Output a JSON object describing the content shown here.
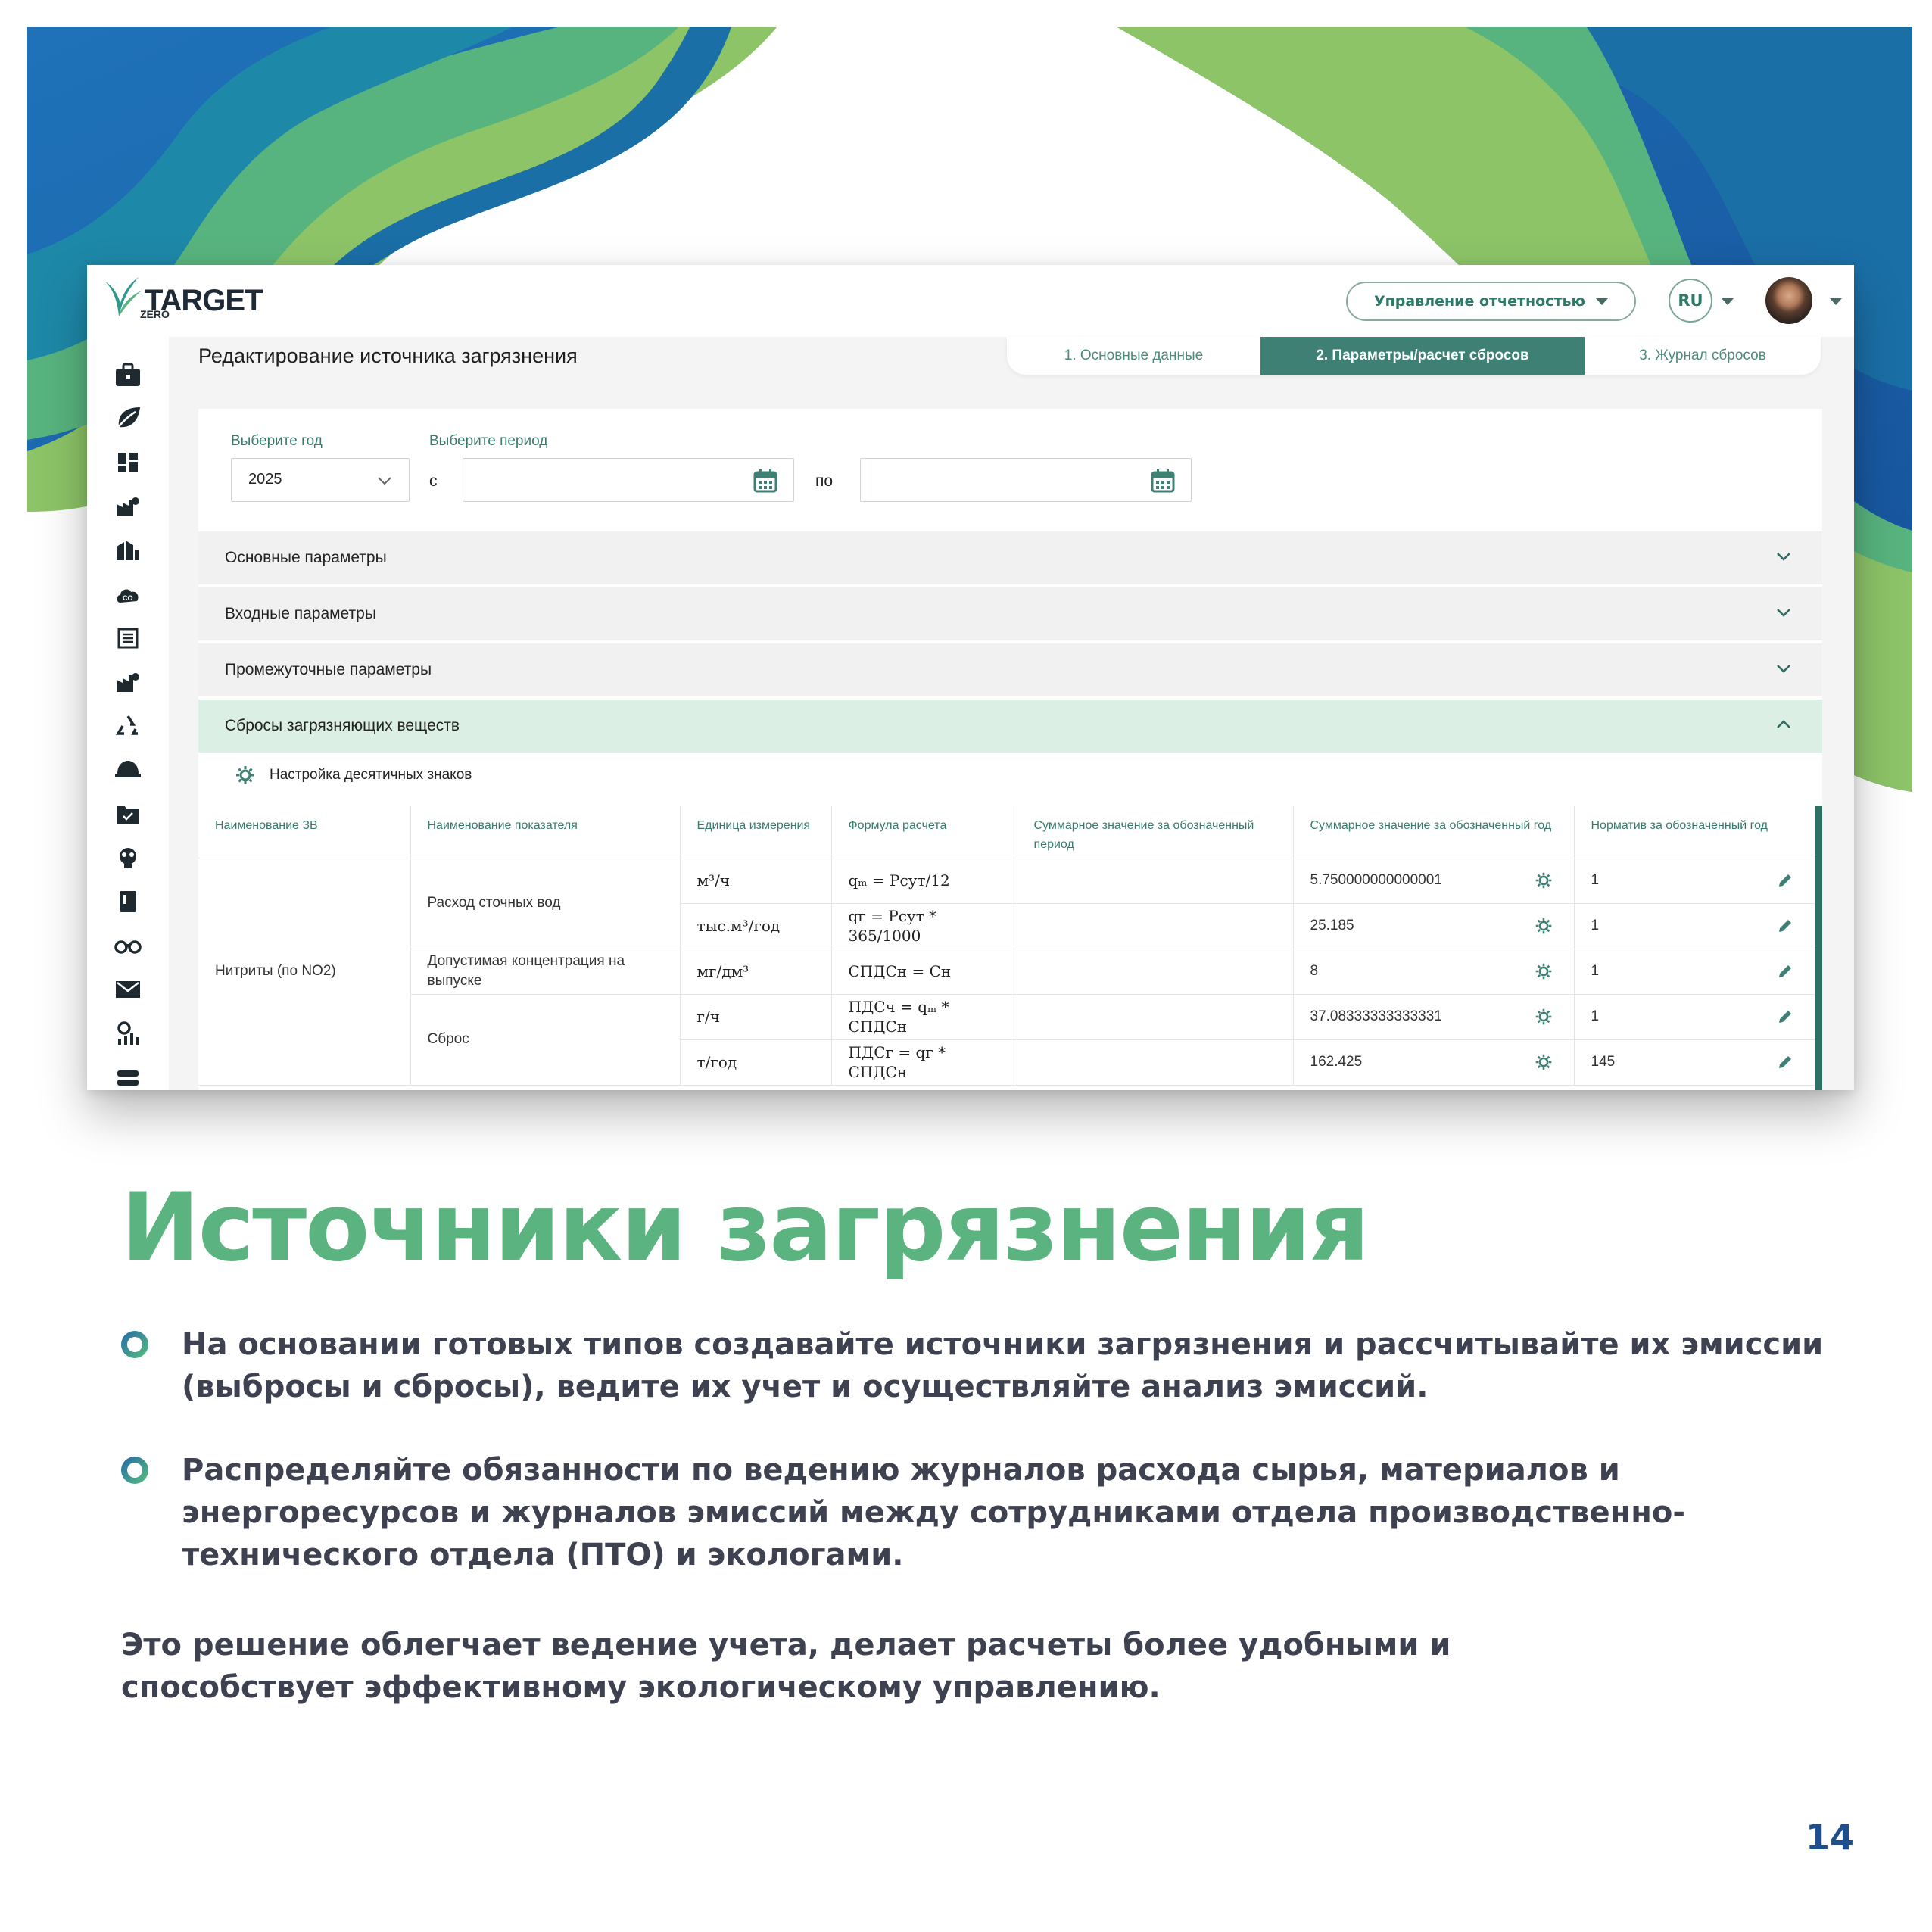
{
  "app": {
    "logo": {
      "name": "TARGET",
      "sub": "ZERO"
    },
    "reporting_button": "Управление отчетностью",
    "language": "RU",
    "page_title": "Редактирование источника загрязнения",
    "steps": [
      "1. Основные данные",
      "2. Параметры/расчет сбросов",
      "3. Журнал сбросов"
    ],
    "active_step": 2,
    "filters": {
      "year_label": "Выберите год",
      "year_value": "2025",
      "period_label": "Выберите период",
      "from_label": "с",
      "to_label": "по"
    },
    "accordions": [
      {
        "label": "Основные параметры",
        "open": false
      },
      {
        "label": "Входные параметры",
        "open": false
      },
      {
        "label": "Промежуточные параметры",
        "open": false
      },
      {
        "label": "Сбросы загрязняющих веществ",
        "open": true
      }
    ],
    "decimal_settings": "Настройка десятичных знаков",
    "table": {
      "headers": [
        "Наименование ЗВ",
        "Наименование показателя",
        "Единица измерения",
        "Формула расчета",
        "Суммарное значение за обозначенный период",
        "Суммарное значение за обозначенный год",
        "Норматив за обозначенный год"
      ],
      "substance": "Нитриты (по NO2)",
      "indicators": [
        "Расход сточных вод",
        "Допустимая концентрация на выпуске",
        "Сброс"
      ],
      "rows": [
        {
          "unit": "м³/ч",
          "formula": "qₘ = Pсут/12",
          "period": "",
          "year": "5.750000000000001",
          "norm": "1"
        },
        {
          "unit": "тыс.м³/год",
          "formula": "qг = Pсут * 365/1000",
          "period": "",
          "year": "25.185",
          "norm": "1"
        },
        {
          "unit": "мг/дм³",
          "formula": "CПДСн = Cн",
          "period": "",
          "year": "8",
          "norm": "1"
        },
        {
          "unit": "г/ч",
          "formula": "ПДСч = qₘ * CПДСн",
          "period": "",
          "year": "37.08333333333331",
          "norm": "1"
        },
        {
          "unit": "т/год",
          "formula": "ПДСг = qг * CПДСн",
          "period": "",
          "year": "162.425",
          "norm": "145"
        }
      ]
    }
  },
  "slide": {
    "heading": "Источники загрязнения",
    "bullets": [
      "На основании готовых типов создавайте источники загрязнения и рассчитывайте их эмиссии (выбросы и сбросы), ведите их учет и осуществляйте анализ эмиссий.",
      "Распределяйте обязанности по ведению журналов расхода сырья, материалов и энергоресурсов и журналов эмиссий между сотрудниками отдела производственно-технического отдела (ПТО) и экологами."
    ],
    "closing": "Это решение облегчает ведение учета, делает расчеты более удобными и способствует эффективному экологическому управлению.",
    "page_number": "14"
  },
  "colors": {
    "accent_green": "#5bb37f",
    "dark_teal": "#3f8074",
    "brand_blue": "#1f4e8c",
    "text_dark": "#3d4150"
  },
  "icons": [
    "briefcase-icon",
    "leaf-icon",
    "dashboard-icon",
    "factory-icon",
    "buildings-icon",
    "co2-cloud-icon",
    "list-icon",
    "factory-icon",
    "recycle-icon",
    "helmet-icon",
    "folder-check-icon",
    "gas-mask-icon",
    "notebook-icon",
    "binoculars-icon",
    "mail-icon",
    "analytics-icon",
    "gear-icon",
    "pencil-icon",
    "calendar-icon",
    "chevron-down-icon",
    "chevron-up-icon"
  ]
}
